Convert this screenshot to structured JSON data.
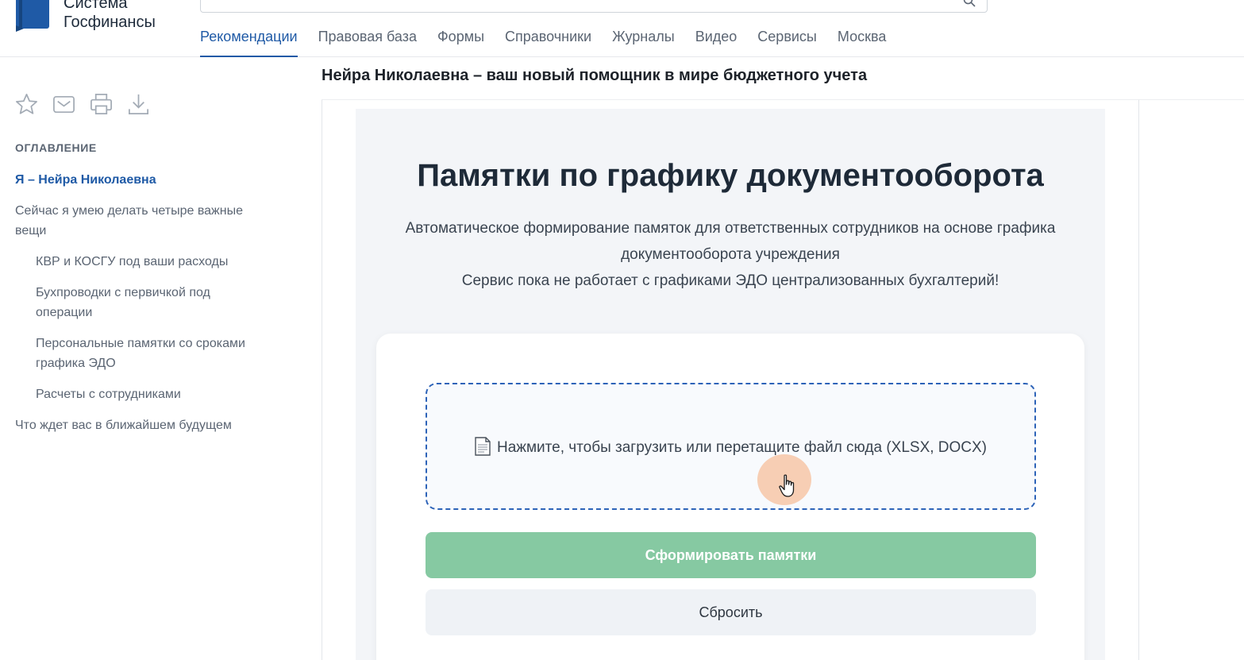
{
  "header": {
    "brand_line1": "Система",
    "brand_line2": "Госфинансы",
    "search_placeholder": "",
    "nav": [
      {
        "label": "Рекомендации",
        "active": true
      },
      {
        "label": "Правовая база"
      },
      {
        "label": "Формы"
      },
      {
        "label": "Справочники"
      },
      {
        "label": "Журналы"
      },
      {
        "label": "Видео"
      },
      {
        "label": "Сервисы"
      },
      {
        "label": "Москва"
      }
    ]
  },
  "toolbar": {
    "icons": [
      "star-icon",
      "mail-icon",
      "print-icon",
      "download-icon"
    ]
  },
  "toc": {
    "heading": "ОГЛАВЛЕНИЕ",
    "items": [
      {
        "label": "Я – Нейра Николаевна",
        "active": true
      },
      {
        "label": "Сейчас я умею делать четыре важные вещи"
      },
      {
        "label": "КВР и КОСГУ под ваши расходы",
        "sub": true
      },
      {
        "label": "Бухпроводки с первичкой под операции",
        "sub": true
      },
      {
        "label": "Персональные памятки со сроками графика ЭДО",
        "sub": true
      },
      {
        "label": "Расчеты с сотрудниками",
        "sub": true
      },
      {
        "label": "Что ждет вас в ближайшем будущем"
      }
    ]
  },
  "document": {
    "title": "Нейра Николаевна –  ваш новый помощник в мире бюджетного учета"
  },
  "app": {
    "title": "Памятки по графику документооборота",
    "description": "Автоматическое формирование памяток для ответственных сотрудников на основе графика документооборота учреждения",
    "note": "Сервис пока не работает с графиками ЭДО централизованных бухгалтерий!",
    "dropzone_text": "Нажмите, чтобы загрузить или перетащите файл сюда (XLSX, DOCX)",
    "primary_button": "Сформировать памятки",
    "secondary_button": "Сбросить"
  },
  "colors": {
    "accent": "#1f5aa6",
    "primary_button": "#86c9a2",
    "dropzone_border": "#2d63b8",
    "cursor_highlight": "#f5aa78"
  }
}
